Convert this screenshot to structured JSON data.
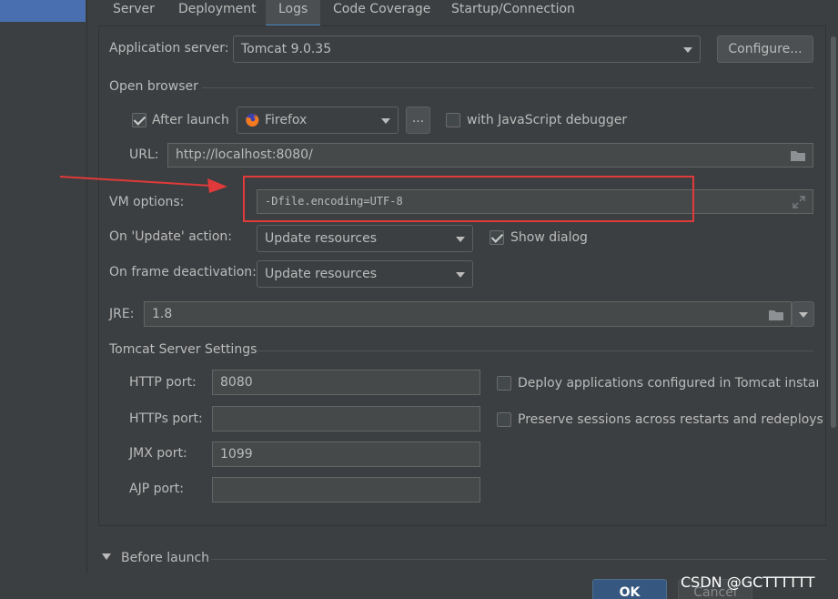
{
  "tabs": [
    "Server",
    "Deployment",
    "Logs",
    "Code Coverage",
    "Startup/Connection"
  ],
  "active_tab": "Logs",
  "app_server": {
    "label": "Application server:",
    "value": "Tomcat 9.0.35",
    "configure_label": "Configure..."
  },
  "open_browser": {
    "title": "Open browser",
    "after_launch_label": "After launch",
    "after_launch_checked": true,
    "browser": "Firefox",
    "more_label": "...",
    "js_debugger_label": "with JavaScript debugger",
    "js_debugger_checked": false,
    "url_label": "URL:",
    "url_value": "http://localhost:8080/"
  },
  "vm_options": {
    "label": "VM options:",
    "value": "-Dfile.encoding=UTF-8"
  },
  "on_update": {
    "label": "On 'Update' action:",
    "value": "Update resources",
    "show_dialog_label": "Show dialog",
    "show_dialog_checked": true
  },
  "on_frame": {
    "label": "On frame deactivation:",
    "value": "Update resources"
  },
  "jre": {
    "label": "JRE:",
    "value": "1.8"
  },
  "tomcat": {
    "title": "Tomcat Server Settings",
    "http_port_label": "HTTP port:",
    "http_port": "8080",
    "https_port_label": "HTTPs port:",
    "https_port": "",
    "jmx_port_label": "JMX port:",
    "jmx_port": "1099",
    "ajp_port_label": "AJP port:",
    "ajp_port": "",
    "deploy_label": "Deploy applications configured in Tomcat instance",
    "preserve_label": "Preserve sessions across restarts and redeploys"
  },
  "before_launch": {
    "title": "Before launch"
  },
  "footer": {
    "ok_label": "OK",
    "cancel_label": "Cancel"
  },
  "watermark": "CSDN @GCTTTTTT",
  "colors": {
    "accent": "#4a88c7",
    "annotation_red": "#e03a3a",
    "ok_blue": "#365880"
  }
}
